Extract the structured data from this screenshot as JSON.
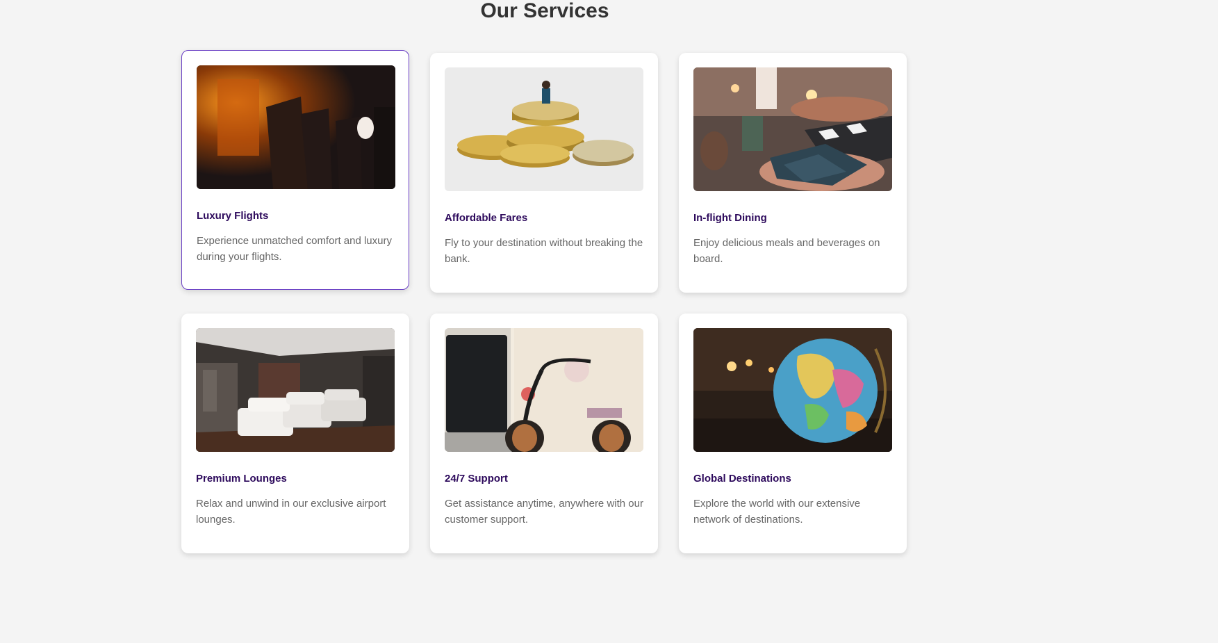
{
  "section": {
    "title": "Our Services"
  },
  "cards": [
    {
      "title": "Luxury Flights",
      "description": "Experience unmatched comfort and luxury during your flights.",
      "image": "airplane-cabin-image"
    },
    {
      "title": "Affordable Fares",
      "description": "Fly to your destination without breaking the bank.",
      "image": "coins-stack-image"
    },
    {
      "title": "In-flight Dining",
      "description": "Enjoy delicious meals and beverages on board.",
      "image": "dining-table-image"
    },
    {
      "title": "Premium Lounges",
      "description": "Relax and unwind in our exclusive airport lounges.",
      "image": "lounge-seats-image"
    },
    {
      "title": "24/7 Support",
      "description": "Get assistance anytime, anywhere with our customer support.",
      "image": "headset-image"
    },
    {
      "title": "Global Destinations",
      "description": "Explore the world with our extensive network of destinations.",
      "image": "globe-image"
    }
  ],
  "colors": {
    "background": "#f4f4f4",
    "card": "#ffffff",
    "title_text": "#333333",
    "card_title": "#2d0a5c",
    "card_text": "#666666",
    "active_border": "#6a3fc4"
  }
}
